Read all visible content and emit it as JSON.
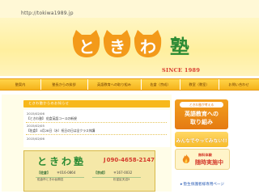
{
  "browser": {
    "url": "http://tokiwa1989.jp"
  },
  "header": {
    "logo_text": "ときわ塾",
    "since": "SINCE 1989"
  },
  "nav": {
    "items": [
      {
        "label": "塾案内"
      },
      {
        "label": "塾長からの挨拶"
      },
      {
        "label": "英語教育への取り組み"
      },
      {
        "label": "佐倉（京成）"
      },
      {
        "label": "教室（教室）"
      },
      {
        "label": "お問い合わせ"
      }
    ]
  },
  "news": {
    "header": "ときわ塾からのお知らせ",
    "items": [
      {
        "date": "2015/02/06",
        "text": "【ときわ塾】 佐倉英語コースの新規"
      },
      {
        "date": "2015/02/05",
        "text": "【佐倉】 4月28日（水）祝日の日は全クラス休講"
      },
      {
        "date": "2015/02/06",
        "text": ""
      }
    ]
  },
  "banner": {
    "name": "ときわ塾",
    "phone_label": "J",
    "phone": "090-4658-2147",
    "branches": [
      {
        "name": "【佐倉】",
        "zip": "〒016-0864",
        "address": "佐倉市ときわ台周辺"
      },
      {
        "name": "【京成】",
        "zip": "〒167-0032",
        "address": "杉並区天沼3"
      }
    ]
  },
  "sidebar": {
    "card1": {
      "pill": "ときわ塾が考える",
      "line1": "英語教育への",
      "line2": "取り組み"
    },
    "card2": {
      "text": "みんなでやってみない!!"
    },
    "card3": {
      "line1": "無料体験",
      "line2": "随時実施中"
    },
    "footer_link": "塾生保護者様専用ページ"
  },
  "colors": {
    "accent_orange": "#f5b21a",
    "logo_orange": "#f39a1a",
    "logo_green": "#2c8b34",
    "since_red": "#d7392c"
  }
}
